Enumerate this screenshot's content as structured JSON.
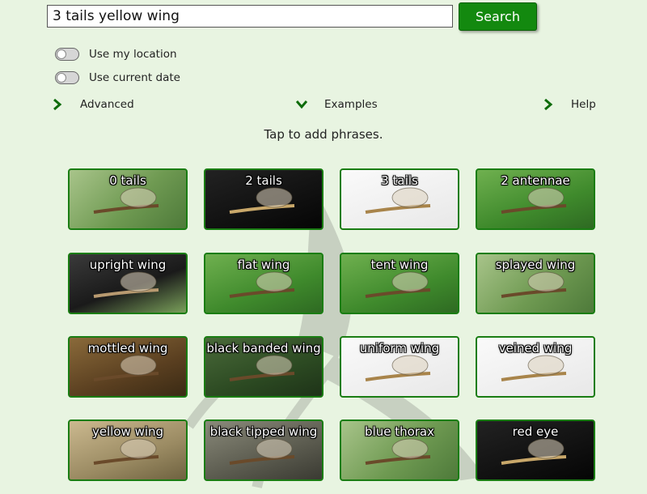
{
  "search": {
    "value": "3 tails yellow wing",
    "button_label": "Search"
  },
  "options": {
    "use_location_label": "Use my location",
    "use_location_on": false,
    "use_date_label": "Use current date",
    "use_date_on": false
  },
  "nav": {
    "advanced_label": "Advanced",
    "examples_label": "Examples",
    "help_label": "Help"
  },
  "hint": "Tap to add phrases.",
  "colors": {
    "background": "#e8f4e1",
    "accent_green": "#13890f",
    "tile_border": "#1a7d13"
  },
  "tiles": [
    {
      "label": "0 tails",
      "theme": "green-field",
      "icon": "damselfly-icon"
    },
    {
      "label": "2 tails",
      "theme": "black",
      "icon": "mayfly-icon"
    },
    {
      "label": "3 tails",
      "theme": "white",
      "icon": "mayfly-icon"
    },
    {
      "label": "2 antennae",
      "theme": "green-leaf",
      "icon": "beetle-icon"
    },
    {
      "label": "upright wing",
      "theme": "dark",
      "icon": "mayfly-icon"
    },
    {
      "label": "flat wing",
      "theme": "green-leaf",
      "icon": "stonefly-icon"
    },
    {
      "label": "tent wing",
      "theme": "green-leaf",
      "icon": "caddisfly-icon"
    },
    {
      "label": "splayed wing",
      "theme": "green-field",
      "icon": "dragonfly-icon"
    },
    {
      "label": "mottled wing",
      "theme": "brown",
      "icon": "mayfly-icon"
    },
    {
      "label": "black banded wing",
      "theme": "green-dark",
      "icon": "dragonfly-icon"
    },
    {
      "label": "uniform wing",
      "theme": "white",
      "icon": "mayfly-icon"
    },
    {
      "label": "veined wing",
      "theme": "white",
      "icon": "stonefly-icon"
    },
    {
      "label": "yellow wing",
      "theme": "tan",
      "icon": "mayfly-icon"
    },
    {
      "label": "black tipped wing",
      "theme": "grey",
      "icon": "dragonfly-icon"
    },
    {
      "label": "blue thorax",
      "theme": "green-field",
      "icon": "damselfly-icon"
    },
    {
      "label": "red eye",
      "theme": "black",
      "icon": "mayfly-icon"
    }
  ]
}
